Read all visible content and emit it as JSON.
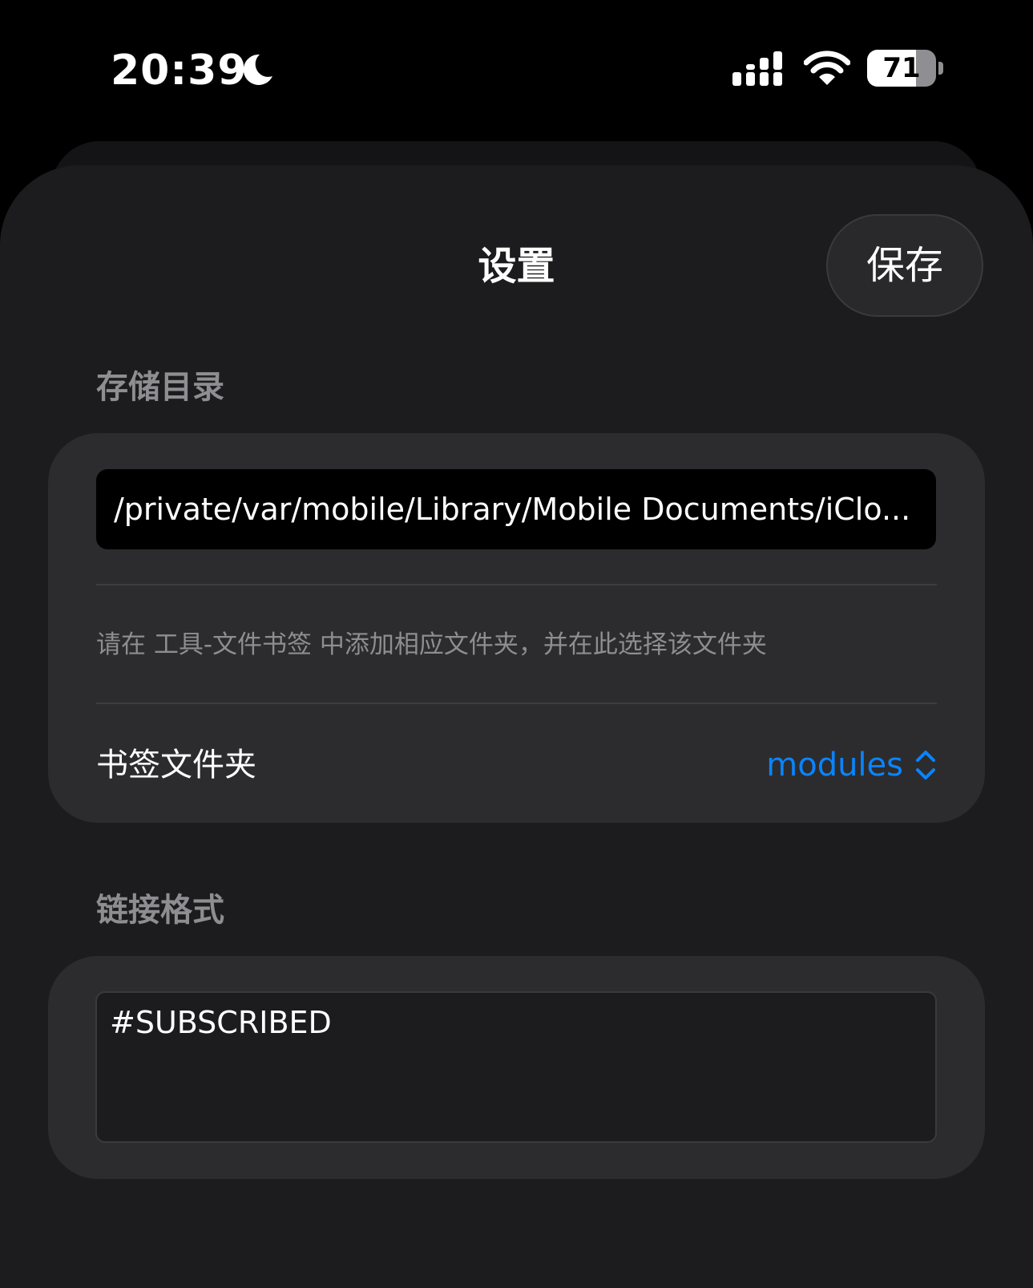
{
  "status_bar": {
    "time": "20:39",
    "battery_level": "71",
    "battery_fraction": 0.71
  },
  "nav": {
    "title": "设置",
    "save_label": "保存"
  },
  "storage_section": {
    "header": "存储目录",
    "path_value": "/private/var/mobile/Library/Mobile Documents/iClo...",
    "hint": "请在 工具-文件书签 中添加相应文件夹，并在此选择该文件夹",
    "folder_label": "书签文件夹",
    "folder_value": "modules"
  },
  "link_section": {
    "header": "链接格式",
    "format_value": "#SUBSCRIBED"
  },
  "colors": {
    "background": "#000000",
    "sheet": "#1c1c1e",
    "card": "#2c2c2e",
    "accent": "#0a84ff",
    "secondary_text": "#8d8d92"
  },
  "icons": [
    "moon-icon",
    "cellular-signal-icon",
    "wifi-icon",
    "battery-icon",
    "chevron-updown-icon"
  ]
}
